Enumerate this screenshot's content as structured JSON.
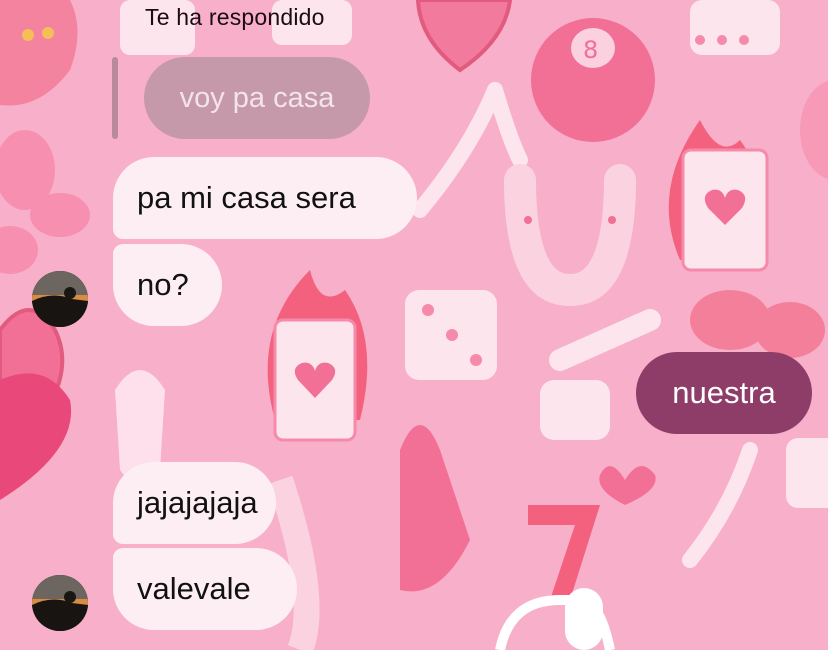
{
  "reply": {
    "header": "Te ha respondido",
    "quoted_text": "voy pa casa"
  },
  "messages": [
    {
      "sender": "other",
      "text": "pa mi casa sera"
    },
    {
      "sender": "other",
      "text": "no?"
    },
    {
      "sender": "me",
      "text": "nuestra"
    },
    {
      "sender": "other",
      "text": "jajajajaja"
    },
    {
      "sender": "other",
      "text": "valevale"
    }
  ],
  "colors": {
    "background": "#f8afc9",
    "incoming_bubble": "#fdeef3",
    "outgoing_bubble": "#8e3d68",
    "quoted_bubble": "#c599aa"
  },
  "icons": {
    "avatar": "profile-photo-sunset"
  }
}
